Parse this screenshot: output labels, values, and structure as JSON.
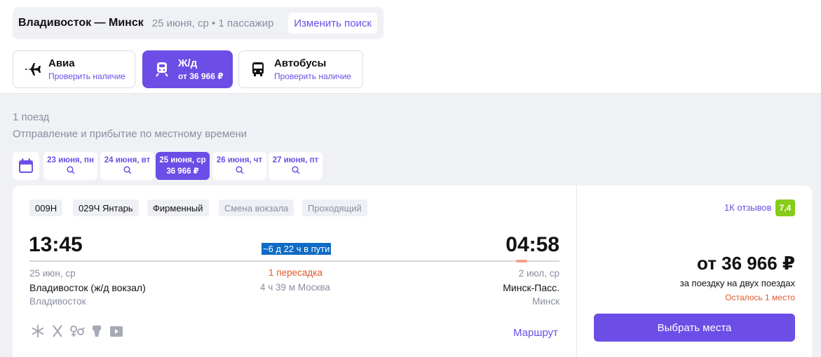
{
  "search": {
    "route": "Владивосток — Минск",
    "meta": "25 июня, ср • 1 пассажир",
    "change_label": "Изменить поиск"
  },
  "modes": [
    {
      "title": "Авиа",
      "sub": "Проверить наличие",
      "icon": "airplane-icon"
    },
    {
      "title": "Ж/д",
      "sub": "от 36 966 ₽",
      "icon": "train-icon"
    },
    {
      "title": "Автобусы",
      "sub": "Проверить наличие",
      "icon": "bus-icon"
    }
  ],
  "results": {
    "count": "1 поезд",
    "timezone_note": "Отправление и прибытие по местному времени"
  },
  "dates": [
    {
      "label": "23 июня, пн",
      "sub": ""
    },
    {
      "label": "24 июня, вт",
      "sub": ""
    },
    {
      "label": "25 июня, ср",
      "sub": "36 966 ₽"
    },
    {
      "label": "26 июня, чт",
      "sub": ""
    },
    {
      "label": "27 июня, пт",
      "sub": ""
    }
  ],
  "train": {
    "tags": [
      "009Н",
      "029Ч Янтарь",
      "Фирменный",
      "Смена вокзала",
      "Проходящий"
    ],
    "dep_time": "13:45",
    "arr_time": "04:58",
    "duration": "~6 д 22 ч в пути",
    "dep_date": "25 июн, ср",
    "arr_date": "2 июл, ср",
    "transfer": "1 пересадка",
    "transfer_info": "4 ч 39 м Москва",
    "dep_station": "Владивосток (ж/д вокзал)",
    "arr_station": "Минск-Пасс.",
    "dep_city": "Владивосток",
    "arr_city": "Минск",
    "route_link": "Маршрут",
    "amenities": [
      "snowflake-icon",
      "restaurant-icon",
      "gender-icon",
      "toilet-icon",
      "media-icon"
    ]
  },
  "offer": {
    "reviews": "1К отзывов",
    "rating": "7,4",
    "price": "от 36 966 ₽",
    "price_sub": "за поездку на двух поездах",
    "left": "Осталось 1 место",
    "select_label": "Выбрать места"
  },
  "colors": {
    "accent": "#6c4ee6",
    "warning": "#e05a2b",
    "rating": "#86cc1a",
    "selection": "#0f6bc4"
  }
}
